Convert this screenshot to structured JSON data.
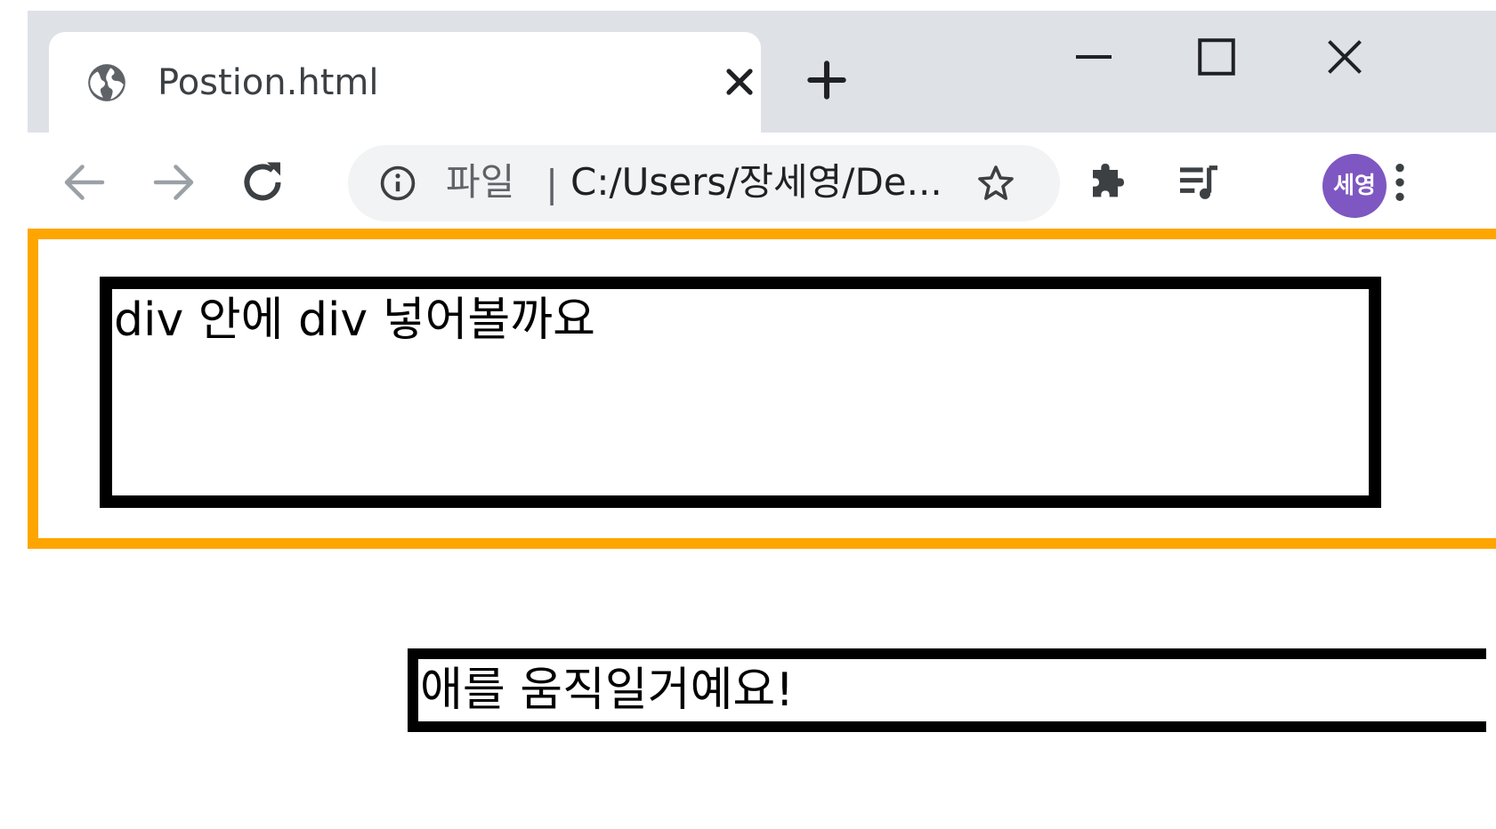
{
  "browser": {
    "tab": {
      "title": "Postion.html",
      "icon": "globe-icon"
    },
    "new_tab_icon": "plus-icon",
    "window_controls": [
      "minimize-icon",
      "maximize-icon",
      "close-icon"
    ],
    "omnibox": {
      "info_icon": "info-icon",
      "scheme_label": "파일",
      "separator": "|",
      "url": "C:/Users/장세영/De...",
      "star_icon": "star-icon"
    },
    "extensions_icon": "puzzle-icon",
    "media_icon": "playlist-icon",
    "profile": {
      "label": "세영",
      "color": "#7e57c2"
    },
    "menu_icon": "kebab-menu-icon"
  },
  "page": {
    "outer_border_color": "#ffa500",
    "inner_text": "div 안에 div 넣어볼까요",
    "moved_text": "애를 움직일거예요!"
  }
}
